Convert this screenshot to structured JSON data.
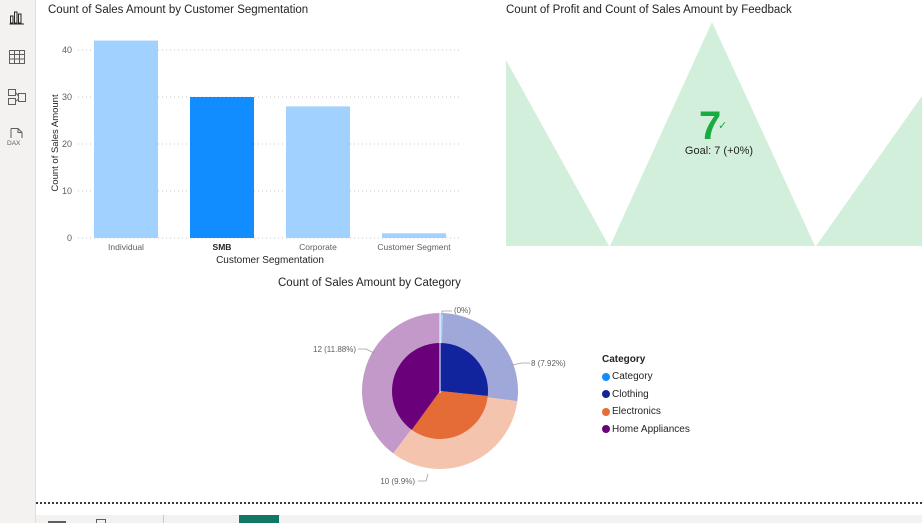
{
  "sidebar": {
    "items": [
      {
        "icon": "report-view-icon",
        "active": true
      },
      {
        "icon": "table-view-icon",
        "active": false
      },
      {
        "icon": "model-view-icon",
        "active": false
      },
      {
        "icon": "dax-query-icon",
        "label": "DAX",
        "active": false
      }
    ]
  },
  "bar_visual": {
    "title": "Count of Sales Amount by Customer Segmentation"
  },
  "kpi_visual": {
    "title": "Count of Profit and Count of Sales Amount by Feedback",
    "value": "7",
    "check": "✓",
    "goal_text": "Goal: 7 (+0%)",
    "value_color": "#1aab40"
  },
  "pie_visual": {
    "title": "Count of Sales Amount by Category",
    "legend_title": "Category"
  },
  "chart_data": [
    {
      "type": "bar",
      "title": "Count of Sales Amount by Customer Segmentation",
      "xlabel": "Customer Segmentation",
      "ylabel": "Count of Sales Amount",
      "categories": [
        "Individual",
        "SMB",
        "Corporate",
        "Customer Segment"
      ],
      "values": [
        42,
        30,
        28,
        1
      ],
      "highlighted": "SMB",
      "yticks": [
        0,
        10,
        20,
        30,
        40
      ],
      "ylim": [
        0,
        43
      ],
      "grid": true,
      "colors": {
        "base": "#a0d1ff",
        "highlight": "#118dff"
      }
    },
    {
      "type": "pie",
      "title": "Count of Sales Amount by Category",
      "legend_title": "Category",
      "legend_position": "right",
      "categories": [
        "Category",
        "Clothing",
        "Electronics",
        "Home Appliances"
      ],
      "colors": [
        "#118dff",
        "#12239e",
        "#e66c37",
        "#6b007b"
      ],
      "inner_values": [
        0,
        8,
        10,
        12
      ],
      "outer_colors": [
        "#a0d1ff",
        "#a0a7d9",
        "#f5c4af",
        "#c399c9"
      ],
      "labels": [
        "(0%)",
        "8 (7.92%)",
        "10 (9.9%)",
        "12 (11.88%)"
      ]
    }
  ]
}
